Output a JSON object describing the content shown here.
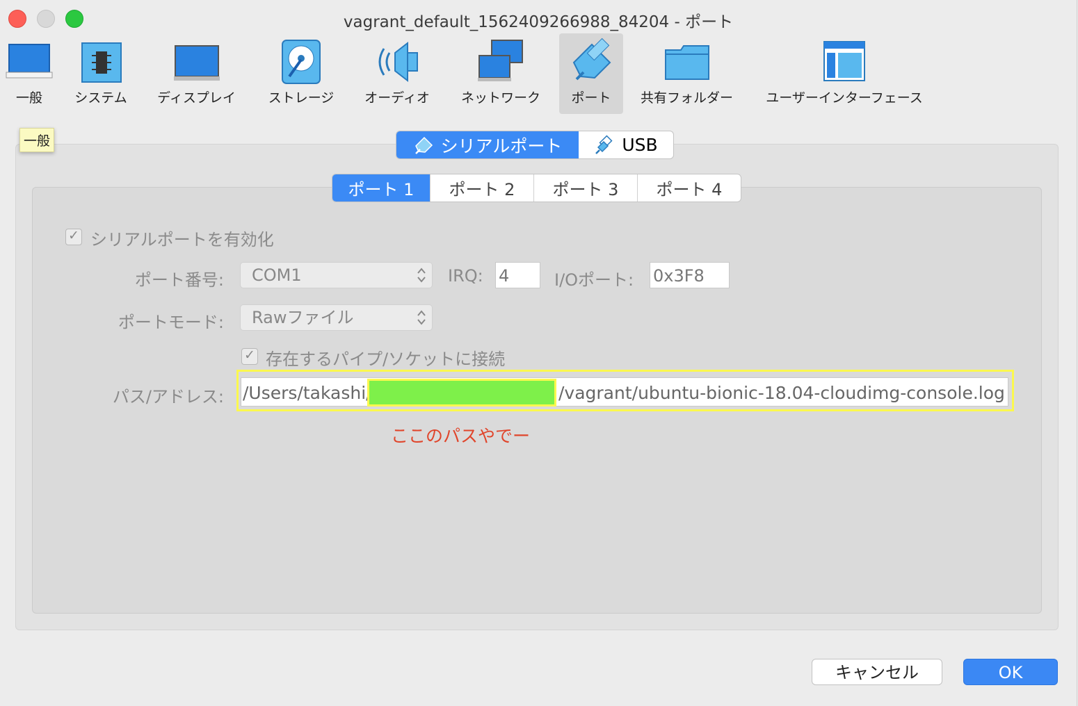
{
  "window": {
    "title": "vagrant_default_1562409266988_84204 - ポート"
  },
  "toolbar": {
    "items": [
      {
        "label": "一般",
        "icon": "monitor-general-icon"
      },
      {
        "label": "システム",
        "icon": "chip-system-icon"
      },
      {
        "label": "ディスプレイ",
        "icon": "display-icon"
      },
      {
        "label": "ストレージ",
        "icon": "storage-disk-icon"
      },
      {
        "label": "オーディオ",
        "icon": "speaker-audio-icon"
      },
      {
        "label": "ネットワーク",
        "icon": "network-icon"
      },
      {
        "label": "ポート",
        "icon": "serial-port-icon"
      },
      {
        "label": "共有フォルダー",
        "icon": "shared-folder-icon"
      },
      {
        "label": "ユーザーインターフェース",
        "icon": "user-interface-icon"
      }
    ],
    "selected": "ポート"
  },
  "tooltip": {
    "text": "一般"
  },
  "tabs": {
    "serial_label": "シリアルポート",
    "usb_label": "USB"
  },
  "port_tabs": [
    "ポート 1",
    "ポート 2",
    "ポート 3",
    "ポート 4"
  ],
  "form": {
    "enable_label": "シリアルポートを有効化",
    "port_number_label": "ポート番号:",
    "port_number_value": "COM1",
    "irq_label": "IRQ:",
    "irq_value": "4",
    "io_label": "I/Oポート:",
    "io_value": "0x3F8",
    "mode_label": "ポートモード:",
    "mode_value": "Rawファイル",
    "connect_label": "存在するパイプ/ソケットに接続",
    "path_label": "パス/アドレス:",
    "path_prefix": "/Users/takashi/",
    "path_suffix": "/vagrant/ubuntu-bionic-18.04-cloudimg-console.log"
  },
  "annotation": {
    "text": "ここのパスやでー"
  },
  "buttons": {
    "cancel": "キャンセル",
    "ok": "OK"
  },
  "colors": {
    "accent": "#3b8af5",
    "highlight": "#fbf84e",
    "redaction": "#7ef04a",
    "annotation": "#e0452b"
  }
}
